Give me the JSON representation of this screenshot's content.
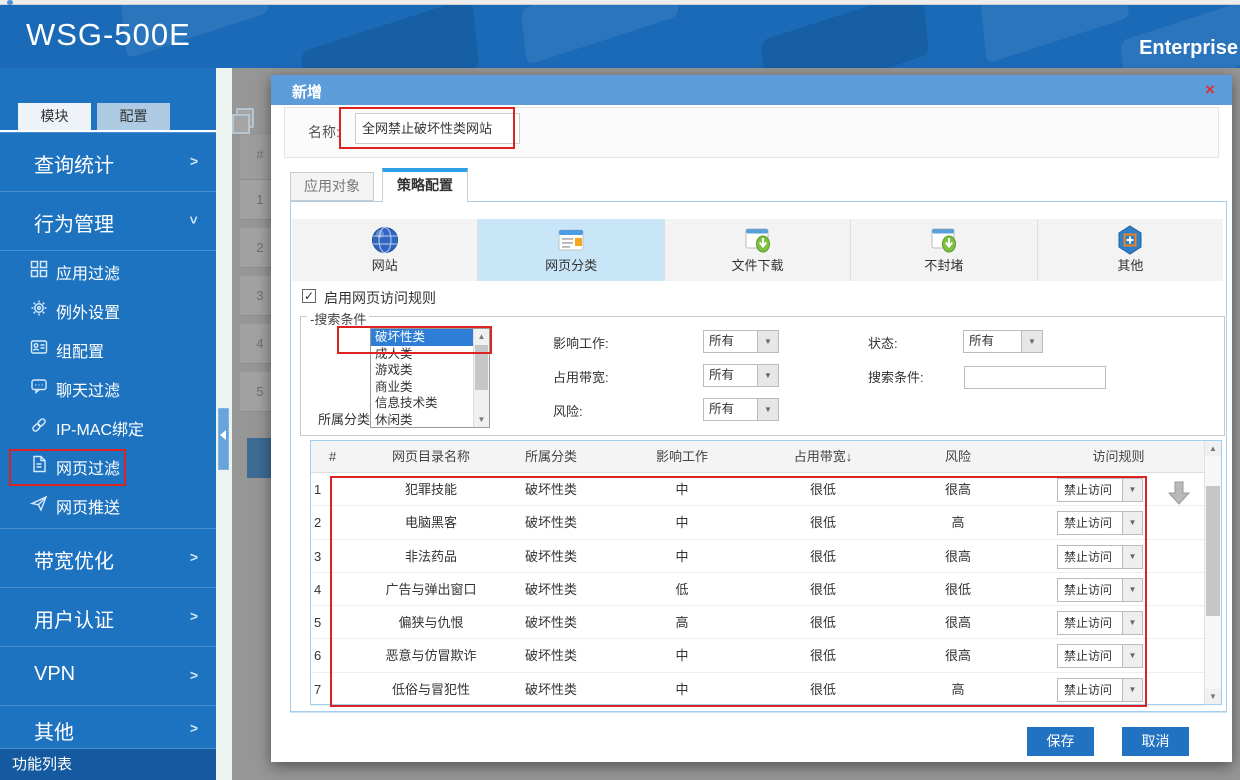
{
  "header": {
    "title": "WSG-500E",
    "right_label": "Enterprise"
  },
  "sidebar": {
    "tabs": [
      {
        "label": "模块"
      },
      {
        "label": "配置"
      }
    ],
    "section_query": {
      "label": "查询统计",
      "chevron": ">"
    },
    "section_behavior": {
      "label": "行为管理",
      "chevron": ">"
    },
    "submenu": [
      {
        "label": "应用过滤"
      },
      {
        "label": "例外设置"
      },
      {
        "label": "组配置"
      },
      {
        "label": "聊天过滤"
      },
      {
        "label": "IP-MAC绑定"
      },
      {
        "label": "网页过滤"
      },
      {
        "label": "网页推送"
      }
    ],
    "section_bandwidth": {
      "label": "带宽优化",
      "chevron": ">"
    },
    "section_auth": {
      "label": "用户认证",
      "chevron": ">"
    },
    "section_vpn": {
      "label": "VPN",
      "chevron": ">"
    },
    "section_other": {
      "label": "其他",
      "chevron": ">"
    },
    "footer": "功能列表"
  },
  "background_page": {
    "col_header": "#",
    "row_numbers": [
      "1",
      "2",
      "3",
      "4",
      "5"
    ]
  },
  "modal": {
    "title": "新增",
    "close": "×",
    "name_label": "名称:",
    "name_value": "全网禁止破坏性类网站",
    "tab_inactive": "应用对象",
    "tab_active": "策略配置",
    "categories": [
      {
        "label": "网站",
        "active": false
      },
      {
        "label": "网页分类",
        "active": true
      },
      {
        "label": "文件下载",
        "active": false
      },
      {
        "label": "不封堵",
        "active": false
      },
      {
        "label": "其他",
        "active": false
      }
    ],
    "enable_rule": {
      "checked": "✓",
      "label": "启用网页访问规则"
    },
    "search": {
      "legend": "-搜索条件",
      "category_label": "所属分类:",
      "category_options": [
        {
          "label": "破坏性类",
          "selected": true
        },
        {
          "label": "成人类",
          "selected": false
        },
        {
          "label": "游戏类",
          "selected": false
        },
        {
          "label": "商业类",
          "selected": false
        },
        {
          "label": "信息技术类",
          "selected": false
        },
        {
          "label": "休闲类",
          "selected": false
        }
      ],
      "impact_label": "影响工作:",
      "impact_value": "所有",
      "bandwidth_label": "占用带宽:",
      "bandwidth_value": "所有",
      "risk_label": "风险:",
      "risk_value": "所有",
      "status_label": "状态:",
      "status_value": "所有",
      "keyword_label": "搜索条件:",
      "keyword_value": ""
    },
    "table": {
      "headers": [
        "#",
        "网页目录名称",
        "所属分类",
        "影响工作",
        "占用带宽↓",
        "风险",
        "访问规则"
      ],
      "rows": [
        {
          "idx": "1",
          "name": "犯罪技能",
          "category": "破坏性类",
          "impact": "中",
          "bandwidth": "很低",
          "risk": "很高",
          "rule": "禁止访问"
        },
        {
          "idx": "2",
          "name": "电脑黑客",
          "category": "破坏性类",
          "impact": "中",
          "bandwidth": "很低",
          "risk": "高",
          "rule": "禁止访问"
        },
        {
          "idx": "3",
          "name": "非法药品",
          "category": "破坏性类",
          "impact": "中",
          "bandwidth": "很低",
          "risk": "很高",
          "rule": "禁止访问"
        },
        {
          "idx": "4",
          "name": "广告与弹出窗口",
          "category": "破坏性类",
          "impact": "低",
          "bandwidth": "很低",
          "risk": "很低",
          "rule": "禁止访问"
        },
        {
          "idx": "5",
          "name": "偏狭与仇恨",
          "category": "破坏性类",
          "impact": "高",
          "bandwidth": "很低",
          "risk": "很高",
          "rule": "禁止访问"
        },
        {
          "idx": "6",
          "name": "恶意与仿冒欺诈",
          "category": "破坏性类",
          "impact": "中",
          "bandwidth": "很低",
          "risk": "很高",
          "rule": "禁止访问"
        },
        {
          "idx": "7",
          "name": "低俗与冒犯性",
          "category": "破坏性类",
          "impact": "中",
          "bandwidth": "很低",
          "risk": "高",
          "rule": "禁止访问"
        }
      ]
    },
    "save_label": "保存",
    "cancel_label": "取消"
  },
  "colors": {
    "banner_blue": "#1a6ab8",
    "sidebar_blue": "#1e73c0",
    "modal_header_blue": "#5b9cd9",
    "selected_option_blue": "#2e7ed7",
    "active_category_bg": "#c9e5f8",
    "button_blue": "#2173c2",
    "annotation_red": "#dd2222"
  }
}
